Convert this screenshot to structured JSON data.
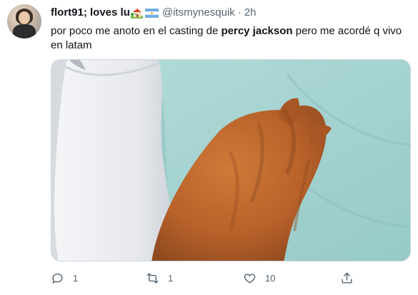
{
  "tweet": {
    "display_name": "flort91; loves lu",
    "handle": "@itsmynesquik",
    "separator": "·",
    "time": "2h",
    "text_before": "por poco me anoto en el casting de ",
    "text_bold": "percy jackson",
    "text_after": " pero me acordé q vivo en latam",
    "name_emojis": [
      "house-with-garden-icon",
      "argentina-flag-icon"
    ]
  },
  "actions": {
    "reply_count": "1",
    "retweet_count": "1",
    "like_count": "10"
  },
  "colors": {
    "text": "#0f1419",
    "secondary": "#536471",
    "border": "#cfd9de",
    "sheet": "#a9d6d3",
    "cat": "#c06a2c"
  }
}
